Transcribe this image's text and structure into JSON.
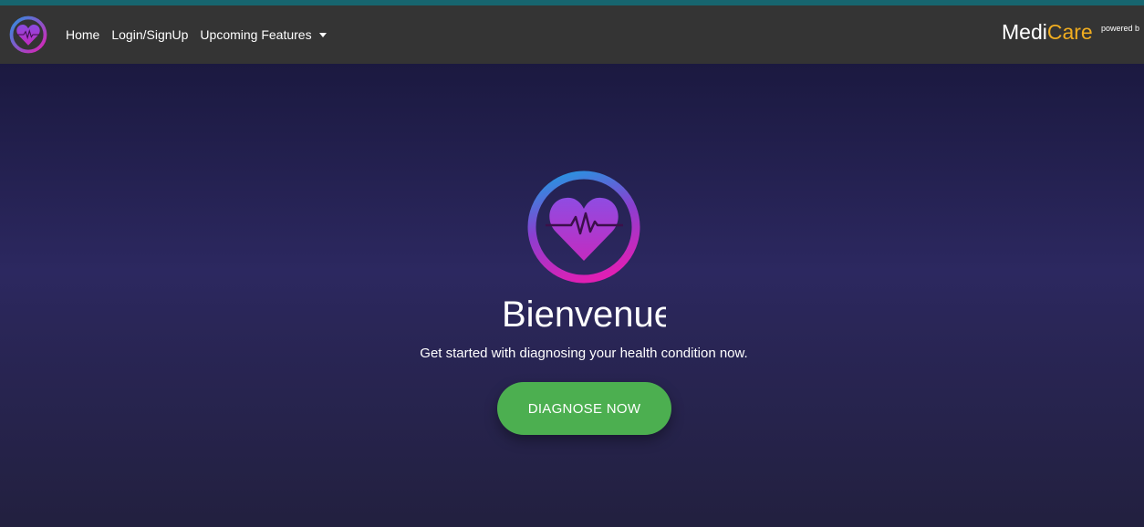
{
  "nav": {
    "logo_icon": "heartbeat-logo-icon",
    "links": [
      {
        "label": "Home"
      },
      {
        "label": "Login/SignUp"
      },
      {
        "label": "Upcoming Features"
      }
    ],
    "dropdown_icon": "caret-down-icon",
    "brand": {
      "part1": "Medi",
      "part2": "Care"
    },
    "powered_text": "powered b"
  },
  "hero": {
    "logo_icon": "heartbeat-logo-icon",
    "title": "Bienvenue",
    "subtitle": "Get started with diagnosing your health condition now.",
    "cta_label": "DIAGNOSE NOW"
  },
  "colors": {
    "top_strip": "#17656f",
    "navbar_bg": "#343434",
    "brand_accent": "#f0ad20",
    "cta_green": "#4caf50",
    "logo_gradient_start": "#2d8fe0",
    "logo_gradient_end": "#e01fb4",
    "hero_bg": "#2c2860"
  }
}
